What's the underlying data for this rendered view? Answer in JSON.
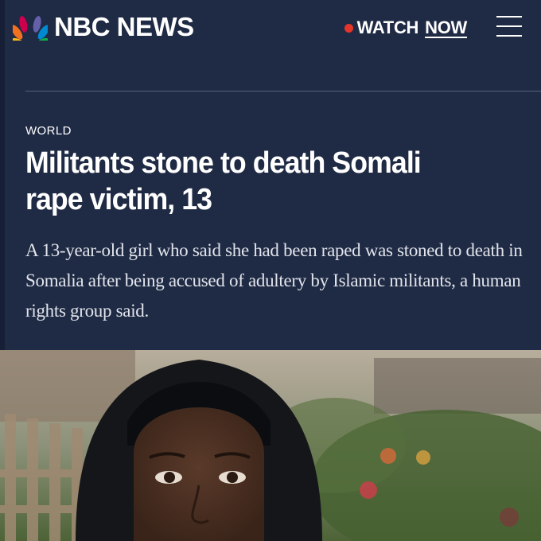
{
  "header": {
    "brand": "NBC NEWS",
    "brand_logo": "nbc-peacock-icon",
    "watch_label": "WATCH",
    "watch_now_label": "NOW",
    "live_dot_color": "#e4352b",
    "menu_icon": "hamburger-menu-icon"
  },
  "article": {
    "section": "WORLD",
    "headline": "Militants stone to death Somali rape victim, 13",
    "dek": "A 13-year-old girl who said she had been raped was stoned to death in Somalia after being accused of adultery by Islamic militants, a human rights group said."
  },
  "colors": {
    "background": "#1f2a44",
    "divider": "#55607a",
    "text": "#ffffff"
  }
}
